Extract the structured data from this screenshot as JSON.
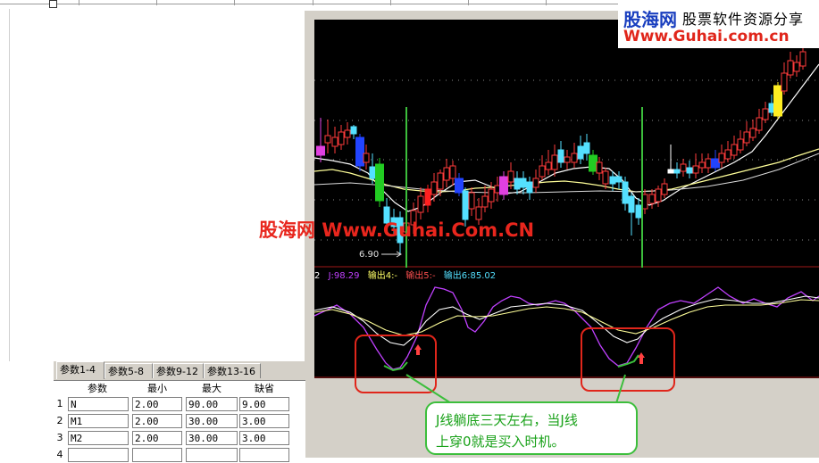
{
  "logo": {
    "brand": "股海网",
    "tagline": "股票软件资源分享",
    "url": "Www.Guhai.com.cn"
  },
  "watermark": "股海网 Www.Guhai.Com.CN",
  "chart": {
    "price_marker": "6.90",
    "indicator_header": {
      "prefix": "2",
      "j": "J:98.29",
      "out4": "输出4:-",
      "out5": "输出5:-",
      "out6": "输出6:85.02"
    }
  },
  "params": {
    "tabs": [
      "参数1-4",
      "参数5-8",
      "参数9-12",
      "参数13-16"
    ],
    "headers": [
      "参数",
      "最小",
      "最大",
      "缺省"
    ],
    "rows": [
      {
        "num": "1",
        "name": "N",
        "min": "2.00",
        "max": "90.00",
        "default": "9.00"
      },
      {
        "num": "2",
        "name": "M1",
        "min": "2.00",
        "max": "30.00",
        "default": "3.00"
      },
      {
        "num": "3",
        "name": "M2",
        "min": "2.00",
        "max": "30.00",
        "default": "3.00"
      },
      {
        "num": "4",
        "name": "",
        "min": "",
        "max": "",
        "default": ""
      }
    ]
  },
  "annotation": {
    "line1": "J线躺底三天左右，当J线",
    "line2": "上穿0就是买入时机。"
  },
  "colors": {
    "annotation_green": "#3cbe3c",
    "highlight_red": "#e0261b",
    "up_candle": "#ff3b3b",
    "down_candle": "#54e0ff",
    "indicator_magenta": "#c040ff"
  }
}
